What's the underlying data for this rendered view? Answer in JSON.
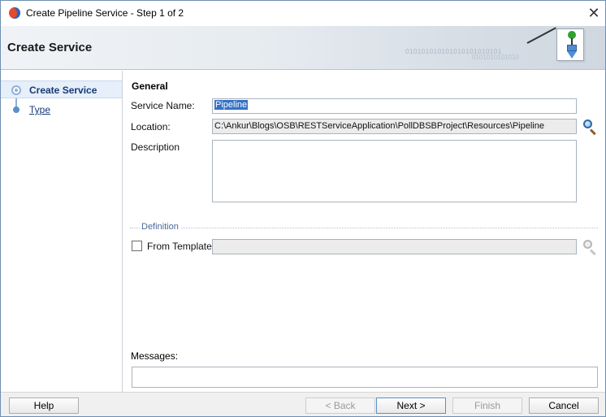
{
  "window": {
    "title": "Create Pipeline Service - Step 1 of 2",
    "close_glyph": "✕"
  },
  "banner": {
    "title": "Create Service",
    "binary_line_1": "010101010101010101010101",
    "binary_line_2": "0101010101010"
  },
  "steps": [
    {
      "label": "Create Service",
      "active": true
    },
    {
      "label": "Type",
      "active": false
    }
  ],
  "form": {
    "section_title": "General",
    "service_name_label": "Service Name:",
    "service_name_value": "Pipeline",
    "location_label": "Location:",
    "location_value": "C:\\Ankur\\Blogs\\OSB\\RESTServiceApplication\\PollDBSBProject\\Resources\\Pipeline",
    "description_label": "Description",
    "description_value": "",
    "definition_title": "Definition",
    "from_template_label": "From Template",
    "from_template_checked": false,
    "template_value": "",
    "messages_label": "Messages:",
    "messages_value": ""
  },
  "buttons": {
    "help": "Help",
    "back": "< Back",
    "next": "Next >",
    "finish": "Finish",
    "cancel": "Cancel"
  },
  "icons": {
    "app": "oracle-jdeveloper-icon",
    "wizard": "wizard-flow-icon",
    "browse": "magnifier-icon",
    "close": "close-icon"
  },
  "colors": {
    "accent": "#163a74",
    "selection": "#3472c6",
    "step_bullet": "#5b8fcc"
  }
}
